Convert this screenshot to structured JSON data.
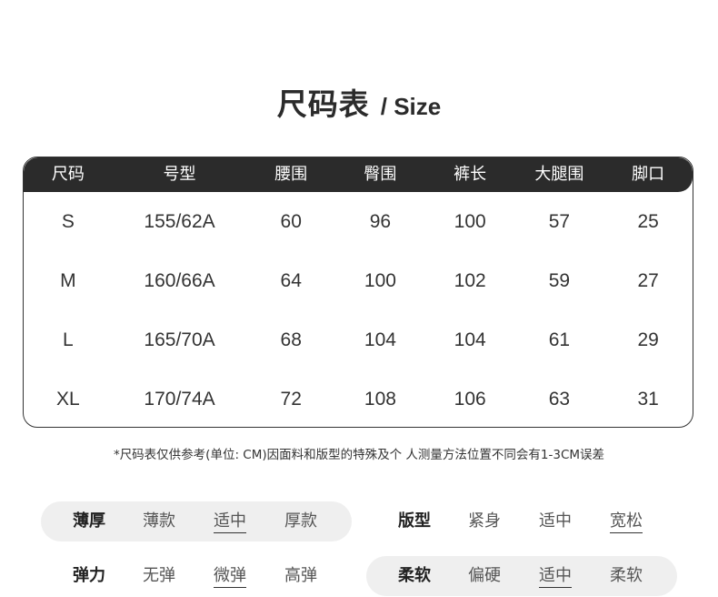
{
  "title": {
    "cn": "尺码表",
    "en": "/ Size"
  },
  "table": {
    "headers": [
      "尺码",
      "号型",
      "腰围",
      "臀围",
      "裤长",
      "大腿围",
      "脚口"
    ],
    "rows": [
      [
        "S",
        "155/62A",
        "60",
        "96",
        "100",
        "57",
        "25"
      ],
      [
        "M",
        "160/66A",
        "64",
        "100",
        "102",
        "59",
        "27"
      ],
      [
        "L",
        "165/70A",
        "68",
        "104",
        "104",
        "61",
        "29"
      ],
      [
        "XL",
        "170/74A",
        "72",
        "108",
        "106",
        "63",
        "31"
      ]
    ]
  },
  "note": "*尺码表仅供参考(单位: CM)因面料和版型的特殊及个 人测量方法位置不同会有1-3CM误差",
  "attributes": [
    {
      "label": "薄厚",
      "options": [
        "薄款",
        "适中",
        "厚款"
      ],
      "selected": 1,
      "shaded": true
    },
    {
      "label": "版型",
      "options": [
        "紧身",
        "适中",
        "宽松"
      ],
      "selected": 2,
      "shaded": false
    },
    {
      "label": "弹力",
      "options": [
        "无弹",
        "微弹",
        "高弹"
      ],
      "selected": 1,
      "shaded": false
    },
    {
      "label": "柔软",
      "options": [
        "偏硬",
        "适中",
        "柔软"
      ],
      "selected": 1,
      "shaded": true
    }
  ],
  "colors": {
    "header_bg": "#2b2b2b",
    "pill_bg": "#efefef"
  }
}
